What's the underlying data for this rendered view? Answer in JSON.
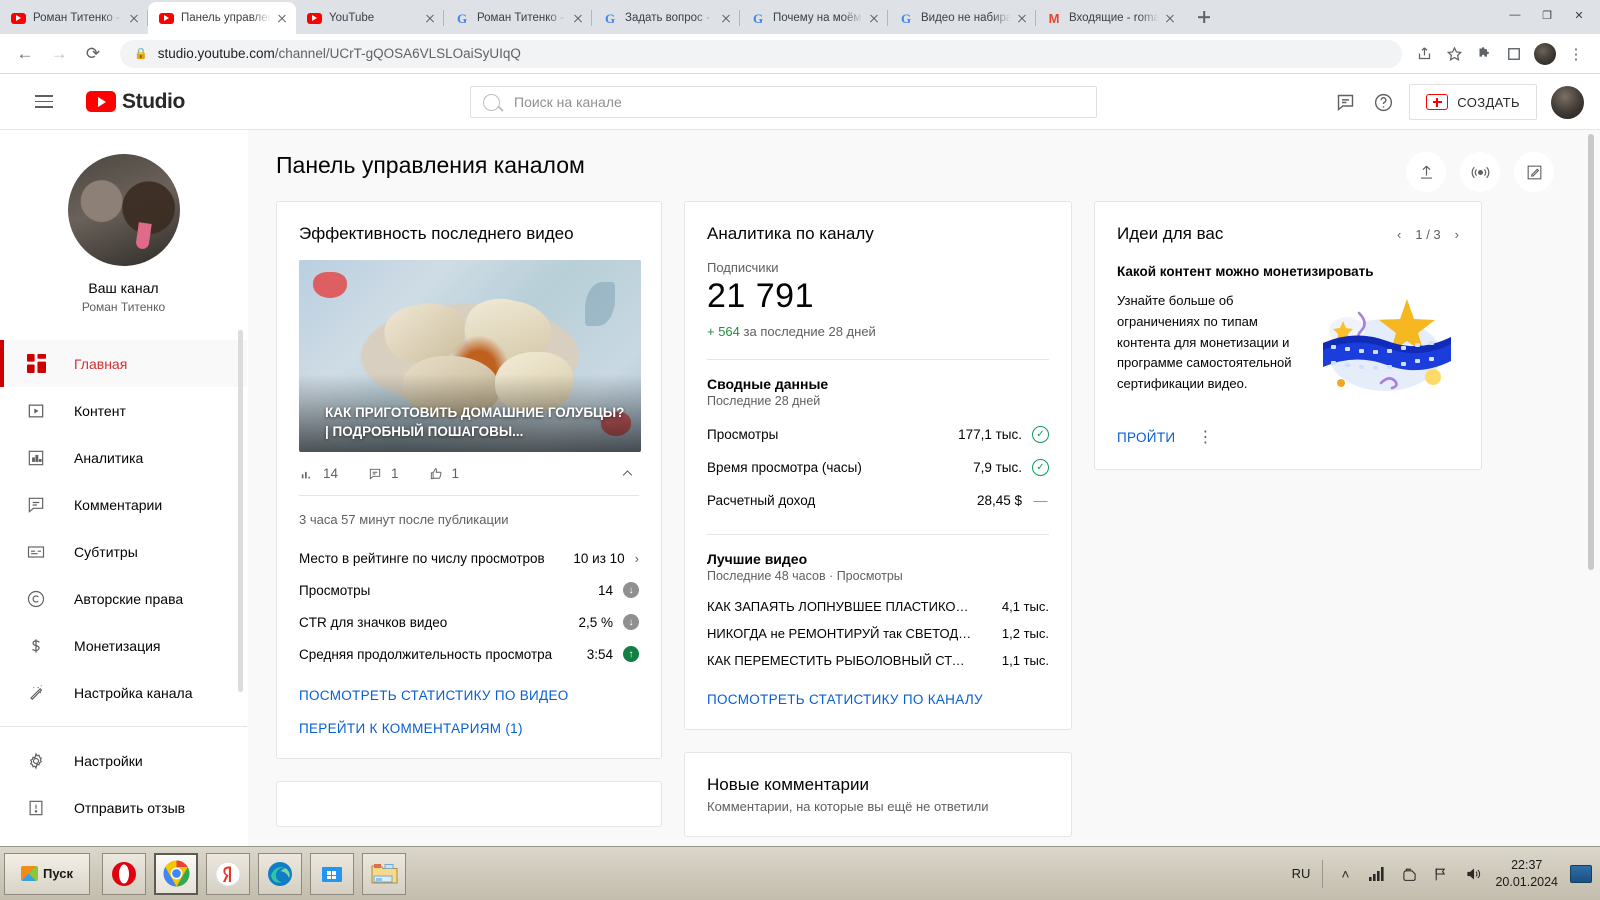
{
  "browser": {
    "tabs": [
      {
        "title": "Роман Титенко - YouTube",
        "favicon": "youtube-icon",
        "active": false
      },
      {
        "title": "Панель управления каналом - YouTube Studio",
        "favicon": "youtube-icon",
        "active": true
      },
      {
        "title": "YouTube",
        "favicon": "youtube-icon",
        "active": false
      },
      {
        "title": "Роман Титенко - Форум",
        "favicon": "google-icon",
        "active": false
      },
      {
        "title": "Задать вопрос - Форум",
        "favicon": "google-icon",
        "active": false
      },
      {
        "title": "Почему на моём канале",
        "favicon": "google-icon",
        "active": false
      },
      {
        "title": "Видео не набирают просмотры",
        "favicon": "google-icon",
        "active": false
      },
      {
        "title": "Входящие - romantitenko",
        "favicon": "gmail-icon",
        "active": false
      }
    ],
    "new_tab_label": "+",
    "window_controls": {
      "minimize": "—",
      "maximize": "❐",
      "close": "✕"
    },
    "url_host": "studio.youtube.com",
    "url_path": "/channel/UCrT-gQOSA6VLSLOaiSyUIqQ",
    "back": "←",
    "forward": "→",
    "reload": "⟳",
    "share_icon": "share-icon",
    "bookmark_icon": "star-icon",
    "extensions_icon": "puzzle-icon",
    "sidepanel_icon": "side-panel-icon",
    "menu_icon": "kebab-menu-icon"
  },
  "studio": {
    "logo_text": "Studio",
    "search": {
      "placeholder": "Поиск на канале",
      "value": ""
    },
    "header": {
      "feedback_icon": "feedback-icon",
      "help_icon": "help-icon",
      "create_label": "СОЗДАТЬ"
    },
    "channel": {
      "your_channel": "Ваш канал",
      "name": "Роман Титенко"
    },
    "nav": [
      {
        "label": "Главная",
        "icon": "dashboard-icon",
        "active": true
      },
      {
        "label": "Контент",
        "icon": "content-icon",
        "active": false
      },
      {
        "label": "Аналитика",
        "icon": "analytics-icon",
        "active": false
      },
      {
        "label": "Комментарии",
        "icon": "comments-icon",
        "active": false
      },
      {
        "label": "Субтитры",
        "icon": "subtitles-icon",
        "active": false
      },
      {
        "label": "Авторские права",
        "icon": "copyright-icon",
        "active": false
      },
      {
        "label": "Монетизация",
        "icon": "monetization-icon",
        "active": false
      },
      {
        "label": "Настройка канала",
        "icon": "customization-icon",
        "active": false
      }
    ],
    "nav_footer": [
      {
        "label": "Настройки",
        "icon": "gear-icon"
      },
      {
        "label": "Отправить отзыв",
        "icon": "feedback-alert-icon"
      }
    ],
    "page_title": "Панель управления каналом",
    "page_actions": [
      {
        "name": "upload-video-button",
        "icon": "upload-icon"
      },
      {
        "name": "go-live-button",
        "icon": "live-broadcast-icon"
      },
      {
        "name": "create-post-button",
        "icon": "edit-post-icon"
      }
    ]
  },
  "latest_video_card": {
    "title": "Эффективность последнего видео",
    "thumb_text": "КАК ПРИГОТОВИТЬ ДОМАШНИЕ ГОЛУБЦЫ? | ПОДРОБНЫЙ ПОШАГОВЫ...",
    "metrics": [
      {
        "icon": "bar-chart-icon",
        "value": "14"
      },
      {
        "icon": "comment-icon",
        "value": "1"
      },
      {
        "icon": "thumbs-up-icon",
        "value": "1"
      }
    ],
    "collapse_icon": "chevron-up-icon",
    "since_publish": "3 часа 57 минут после публикации",
    "stats": [
      {
        "label": "Место в рейтинге по числу просмотров",
        "value": "10 из 10",
        "badge": "chevron-right"
      },
      {
        "label": "Просмотры",
        "value": "14",
        "badge": "down"
      },
      {
        "label": "CTR для значков видео",
        "value": "2,5 %",
        "badge": "down"
      },
      {
        "label": "Средняя продолжительность просмотра",
        "value": "3:54",
        "badge": "up"
      }
    ],
    "link_stats": "ПОСМОТРЕТЬ СТАТИСТИКУ ПО ВИДЕО",
    "link_comments": "ПЕРЕЙТИ К КОММЕНТАРИЯМ (1)"
  },
  "analytics_card": {
    "title": "Аналитика по каналу",
    "subscribers_label": "Подписчики",
    "subscribers_value": "21 791",
    "subscribers_delta_value": "+ 564",
    "subscribers_delta_period": " за последние 28 дней",
    "summary_title": "Сводные данные",
    "summary_period": "Последние 28 дней",
    "summary_rows": [
      {
        "label": "Просмотры",
        "value": "177,1 тыс.",
        "badge": "check"
      },
      {
        "label": "Время просмотра (часы)",
        "value": "7,9 тыс.",
        "badge": "check"
      },
      {
        "label": "Расчетный доход",
        "value": "28,45 $",
        "badge": "dash"
      }
    ],
    "top_videos_title": "Лучшие видео",
    "top_videos_period": "Последние 48 часов · Просмотры",
    "top_videos": [
      {
        "name": "КАК ЗАПАЯТЬ ЛОПНУВШЕЕ ПЛАСТИКОВОЕ В...",
        "views": "4,1 тыс."
      },
      {
        "name": "НИКОГДА не РЕМОНТИРУЙ так СВЕТОДИОД...",
        "views": "1,2 тыс."
      },
      {
        "name": "КАК ПЕРЕМЕСТИТЬ РЫБОЛОВНЫЙ СТОПОР ...",
        "views": "1,1 тыс."
      }
    ],
    "link_channel_stats": "ПОСМОТРЕТЬ СТАТИСТИКУ ПО КАНАЛУ"
  },
  "comments_card": {
    "title": "Новые комментарии",
    "subtitle": "Комментарии, на которые вы ещё не ответили"
  },
  "ideas_card": {
    "title": "Идеи для вас",
    "prev_icon": "chevron-left-icon",
    "counter": "1 / 3",
    "next_icon": "chevron-right-icon",
    "idea_title": "Какой контент можно монетизировать",
    "idea_text": "Узнайте больше об ограничениях по типам контента для монетизации и программе самостоятельной сертификации видео.",
    "cta": "ПРОЙТИ",
    "menu_icon": "kebab-menu-icon"
  },
  "taskbar": {
    "start_label": "Пуск",
    "apps": [
      {
        "name": "opera-taskbar-icon",
        "active": false
      },
      {
        "name": "chrome-taskbar-icon",
        "active": true
      },
      {
        "name": "yandex-browser-taskbar-icon",
        "active": false
      },
      {
        "name": "edge-taskbar-icon",
        "active": false
      },
      {
        "name": "windows-store-taskbar-icon",
        "active": false
      },
      {
        "name": "file-explorer-taskbar-icon",
        "active": false
      }
    ],
    "language": "RU",
    "tray_icons": [
      "show-hidden-icon",
      "network-signal-icon",
      "action-center-icon",
      "flag-icon",
      "volume-icon"
    ],
    "time": "22:37",
    "date": "20.01.2024"
  },
  "colors": {
    "brand_red": "#ff0000",
    "link_blue": "#065fd4",
    "positive_green": "#1e8e3e",
    "neutral_gray": "#909090"
  }
}
